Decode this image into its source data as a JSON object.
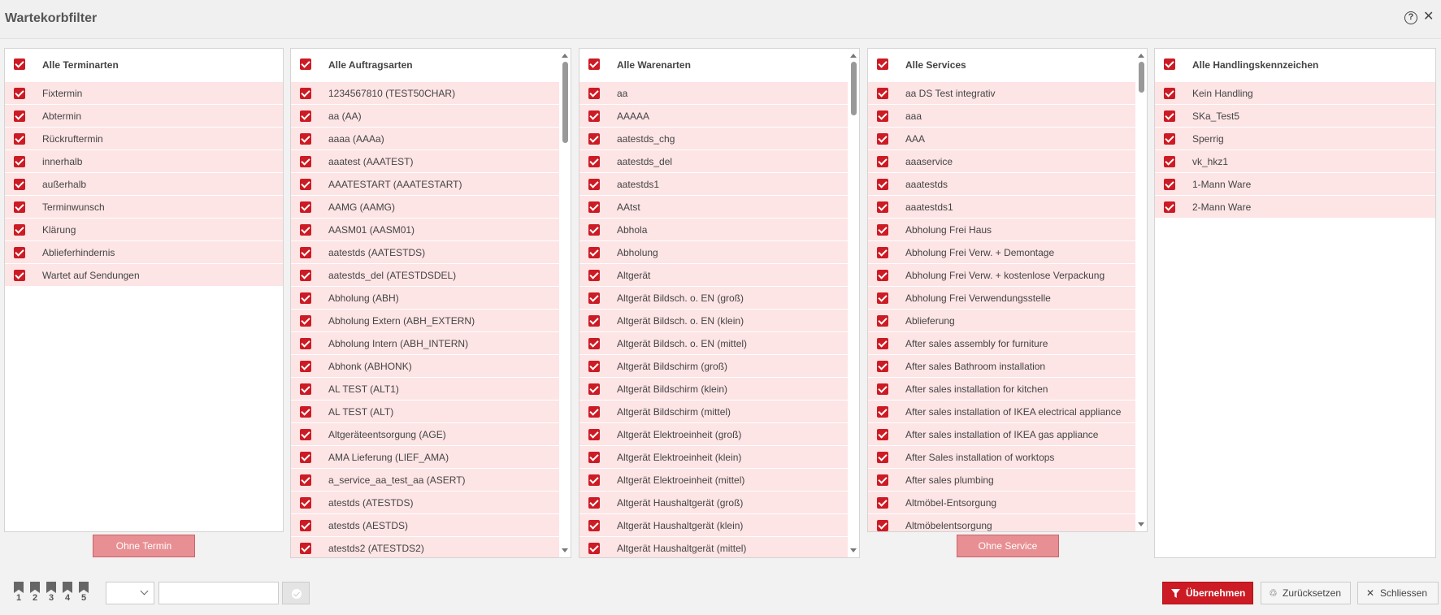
{
  "dialog": {
    "title": "Wartekorbfilter"
  },
  "panels": [
    {
      "header": "Alle Terminarten",
      "items": [
        "Fixtermin",
        "Abtermin",
        "Rückruftermin",
        "innerhalb",
        "außerhalb",
        "Terminwunsch",
        "Klärung",
        "Ablieferhindernis",
        "Wartet auf Sendungen"
      ],
      "button": "Ohne Termin"
    },
    {
      "header": "Alle Auftragsarten",
      "items": [
        "1234567810 (TEST50CHAR)",
        "aa (AA)",
        "aaaa (AAAa)",
        "aaatest (AAATEST)",
        "AAATESTART (AAATESTART)",
        "AAMG (AAMG)",
        "AASM01 (AASM01)",
        "aatestds (AATESTDS)",
        "aatestds_del (ATESTDSDEL)",
        "Abholung (ABH)",
        "Abholung Extern (ABH_EXTERN)",
        "Abholung Intern (ABH_INTERN)",
        "Abhonk (ABHONK)",
        "AL TEST (ALT1)",
        "AL TEST (ALT)",
        "Altgeräteentsorgung (AGE)",
        "AMA Lieferung (LIEF_AMA)",
        "a_service_aa_test_aa (ASERT)",
        "atestds (ATESTDS)",
        "atestds (AESTDS)",
        "atestds2 (ATESTDS2)"
      ]
    },
    {
      "header": "Alle Warenarten",
      "items": [
        "aa",
        "AAAAA",
        "aatestds_chg",
        "aatestds_del",
        "aatestds1",
        "AAtst",
        "Abhola",
        "Abholung",
        "Altgerät",
        "Altgerät Bildsch. o. EN (groß)",
        "Altgerät Bildsch. o. EN (klein)",
        "Altgerät Bildsch. o. EN (mittel)",
        "Altgerät Bildschirm (groß)",
        "Altgerät Bildschirm (klein)",
        "Altgerät Bildschirm (mittel)",
        "Altgerät Elektroeinheit (groß)",
        "Altgerät Elektroeinheit (klein)",
        "Altgerät Elektroeinheit (mittel)",
        "Altgerät Haushaltgerät (groß)",
        "Altgerät Haushaltgerät (klein)",
        "Altgerät Haushaltgerät (mittel)"
      ]
    },
    {
      "header": "Alle Services",
      "items": [
        "aa DS Test integrativ",
        "aaa",
        "AAA",
        "aaaservice",
        "aaatestds",
        "aaatestds1",
        "Abholung Frei Haus",
        "Abholung Frei Verw. + Demontage",
        "Abholung Frei Verw. + kostenlose Verpackung",
        "Abholung Frei Verwendungsstelle",
        "Ablieferung",
        "After sales assembly for furniture",
        "After sales Bathroom installation",
        "After sales installation for kitchen",
        "After sales installation of IKEA electrical appliance",
        "After sales installation of IKEA gas appliance",
        "After Sales installation of worktops",
        "After sales plumbing",
        "Altmöbel-Entsorgung",
        "Altmöbelentsorgung"
      ],
      "button": "Ohne Service"
    },
    {
      "header": "Alle Handlingskennzeichen",
      "items": [
        "Kein Handling",
        "SKa_Test5",
        "Sperrig",
        "vk_hkz1",
        "1-Mann Ware",
        "2-Mann Ware"
      ]
    }
  ],
  "footer": {
    "bookmarks": [
      "1",
      "2",
      "3",
      "4",
      "5"
    ],
    "select_value": "",
    "input_value": "",
    "apply_label": "Übernehmen",
    "reset_label": "Zurücksetzen",
    "close_label": "Schliessen"
  },
  "icons": {
    "help": "help-circle-icon",
    "close": "close-icon",
    "apply": "filter-icon",
    "reset": "recycle-icon",
    "close_button": "x-icon"
  },
  "colors": {
    "accent": "#cc1b24",
    "row_background": "#fde4e5",
    "secondary_button": "#e88f93"
  }
}
